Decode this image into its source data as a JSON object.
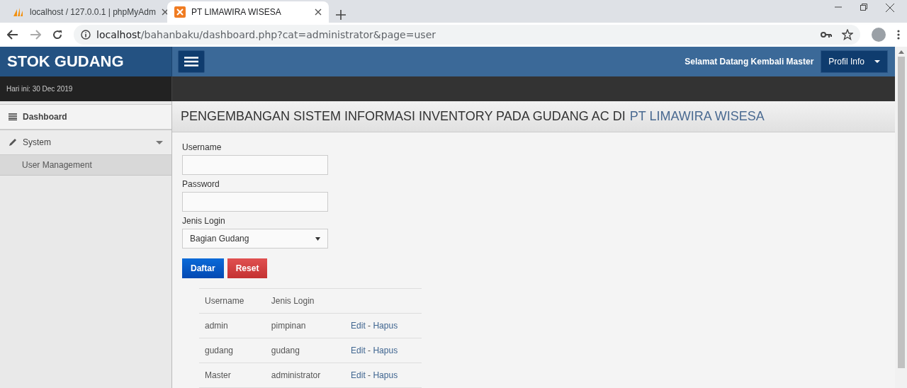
{
  "browser": {
    "tabs": [
      {
        "title": "localhost / 127.0.0.1 | phpMyAdm",
        "selected": false,
        "kind": "pma"
      },
      {
        "title": "PT LIMAWIRA WISESA",
        "selected": true,
        "kind": "xampp"
      }
    ],
    "url_host": "localhost",
    "url_path": "/bahanbaku/dashboard.php?cat=administrator&page=user"
  },
  "header": {
    "brand": "STOK GUDANG",
    "welcome": "Selamat Datang Kembali Master",
    "profile_button": "Profil Info"
  },
  "date_bar": {
    "text": "Hari ini: 30 Dec 2019"
  },
  "sidebar": {
    "items": [
      {
        "label": "Dashboard",
        "kind": "list"
      },
      {
        "label": "System",
        "kind": "pencil",
        "expanded": true,
        "children": [
          {
            "label": "User Management",
            "selected": true
          }
        ]
      }
    ]
  },
  "page_title": {
    "prefix": "PENGEMBANGAN SISTEM INFORMASI INVENTORY PADA GUDANG AC DI",
    "company": "PT LIMAWIRA WISESA"
  },
  "form": {
    "fields": [
      {
        "label": "Username",
        "kind": "text"
      },
      {
        "label": "Password",
        "kind": "password"
      },
      {
        "label": "Jenis Login",
        "kind": "select",
        "value": "Bagian Gudang"
      }
    ],
    "buttons": [
      {
        "label": "Daftar",
        "kind": "primary"
      },
      {
        "label": "Reset",
        "kind": "danger"
      }
    ]
  },
  "table": {
    "columns": [
      "Username",
      "Jenis Login"
    ],
    "rows": [
      {
        "username": "admin",
        "jenis_login": "pimpinan",
        "edit": "Edit",
        "separator": "-",
        "delete": "Hapus"
      },
      {
        "username": "gudang",
        "jenis_login": "gudang",
        "edit": "Edit",
        "separator": "-",
        "delete": "Hapus"
      },
      {
        "username": "Master",
        "jenis_login": "administrator",
        "edit": "Edit",
        "separator": "-",
        "delete": "Hapus"
      }
    ]
  }
}
